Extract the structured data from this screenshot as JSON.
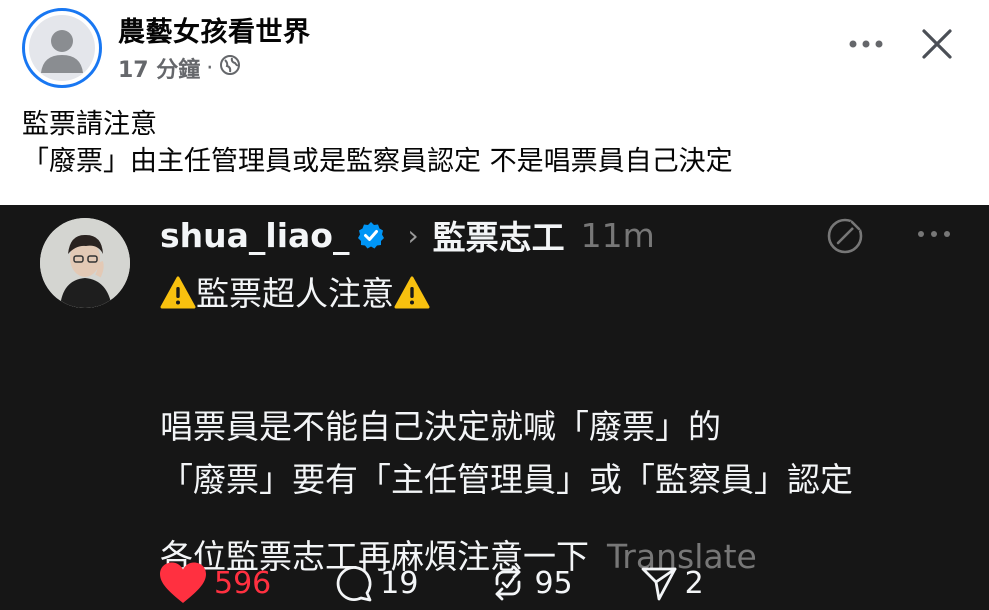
{
  "facebook_post": {
    "author": "農藝女孩看世界",
    "time": "17 分鐘",
    "separator": "·",
    "text_line1": "監票請注意",
    "text_line2": "「廢票」由主任管理員或是監察員認定 不是唱票員自己決定"
  },
  "threads_post": {
    "username": "shua_liao_",
    "chevron": "›",
    "topic": "監票志工",
    "time": "11m",
    "line1": "監票超人注意",
    "line2": "唱票員是不能自己決定就喊「廢票」的",
    "line3": "「廢票」要有「主任管理員」或「監察員」認定",
    "line4": "各位監票志工再麻煩注意一下",
    "translate_label": "Translate",
    "likes": "596",
    "comments": "19",
    "reposts": "95",
    "shares": "2"
  },
  "colors": {
    "facebook_blue": "#1877f2",
    "threads_bg": "#161616",
    "like_red": "#ff3040",
    "muted_gray": "#777777"
  },
  "icons": [
    "globe-icon",
    "more-icon",
    "close-icon",
    "verified-badge-icon",
    "reply-icon",
    "warning-icon",
    "heart-icon",
    "comment-icon",
    "repost-icon",
    "share-icon"
  ]
}
